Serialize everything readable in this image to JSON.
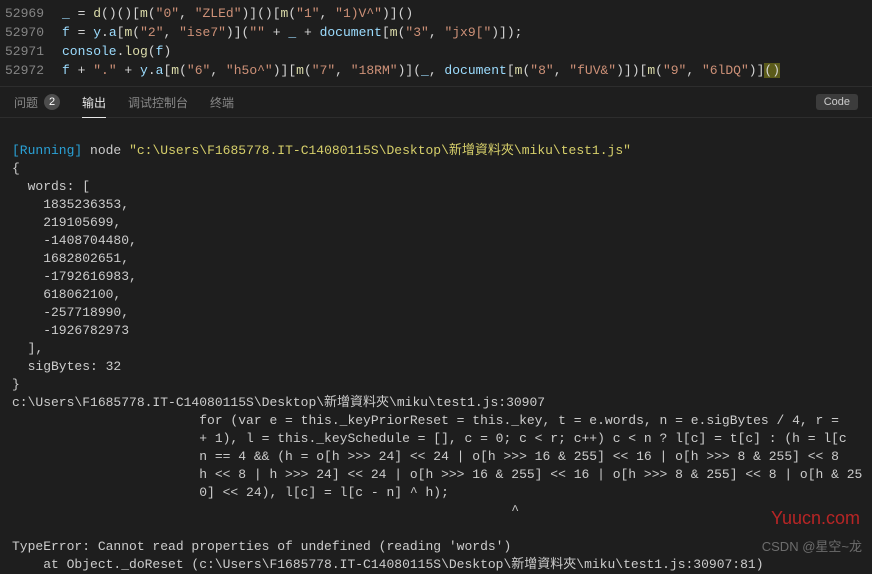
{
  "editor": {
    "lines": [
      {
        "num": "52969",
        "html": "<span class='tok-id'>_</span> = <span class='tok-fn'>d</span>()()[<span class='tok-fn'>m</span>(<span class='tok-str'>\"0\"</span>, <span class='tok-str'>\"ZLEd\"</span>)]()[<span class='tok-fn'>m</span>(<span class='tok-str'>\"1\"</span>, <span class='tok-str'>\"1)V^\"</span>)]()"
      },
      {
        "num": "52970",
        "html": "<span class='tok-id'>f</span> = <span class='tok-id'>y</span>.<span class='tok-id'>a</span>[<span class='tok-fn'>m</span>(<span class='tok-str'>\"2\"</span>, <span class='tok-str'>\"ise7\"</span>)](<span class='tok-str'>\"\"</span> + <span class='tok-id'>_</span> + <span class='tok-id'>document</span>[<span class='tok-fn'>m</span>(<span class='tok-str'>\"3\"</span>, <span class='tok-str'>\"jx9[\"</span>)]);"
      },
      {
        "num": "52971",
        "html": "<span class='tok-id'>console</span>.<span class='tok-fn'>log</span>(<span class='tok-id'>f</span>)"
      },
      {
        "num": "52972",
        "html": "<span class='tok-id'>f</span> + <span class='tok-str'>\".\"</span> + <span class='tok-id'>y</span>.<span class='tok-id'>a</span>[<span class='tok-fn'>m</span>(<span class='tok-str'>\"6\"</span>, <span class='tok-str'>\"h5o^\"</span>)][<span class='tok-fn'>m</span>(<span class='tok-str'>\"7\"</span>, <span class='tok-str'>\"18RM\"</span>)](<span class='tok-id'>_</span>, <span class='tok-id'>document</span>[<span class='tok-fn'>m</span>(<span class='tok-str'>\"8\"</span>, <span class='tok-str'>\"fUV&amp;\"</span>)])[<span class='tok-fn'>m</span>(<span class='tok-str'>\"9\"</span>, <span class='tok-str'>\"6lDQ\"</span>)]<span class='tok-paren-y'>()</span>"
      }
    ]
  },
  "panel": {
    "tabs": {
      "problems": "问题",
      "problems_count": "2",
      "output": "输出",
      "debug": "调试控制台",
      "terminal": "终端"
    },
    "selector": "Code"
  },
  "terminal": {
    "running_label": "[Running]",
    "cmd_node": "node",
    "cmd_path": "\"c:\\Users\\F1685778.IT-C14080115S\\Desktop\\新增資料夾\\miku\\test1.js\"",
    "obj_open": "{",
    "words_open": "  words: [",
    "values": [
      "    1835236353,",
      "    219105699,",
      "    -1408704480,",
      "    1682802651,",
      "    -1792616983,",
      "    618062100,",
      "    -257718990,",
      "    -1926782973"
    ],
    "words_close": "  ],",
    "sigbytes": "  sigBytes: 32",
    "obj_close": "}",
    "trace_path": "c:\\Users\\F1685778.IT-C14080115S\\Desktop\\新增資料夾\\miku\\test1.js:30907",
    "for_l1": "                        for (var e = this._keyPriorReset = this._key, t = e.words, n = e.sigBytes / 4, r = ",
    "for_l2": "                        + 1), l = this._keySchedule = [], c = 0; c < r; c++) c < n ? l[c] = t[c] : (h = l[c",
    "for_l3": "                        n == 4 && (h = o[h >>> 24] << 24 | o[h >>> 16 & 255] << 16 | o[h >>> 8 & 255] << 8 ",
    "for_l4": "                        h << 8 | h >>> 24] << 24 | o[h >>> 16 & 255] << 16 | o[h >>> 8 & 255] << 8 | o[h & 25",
    "for_l5": "                        0] << 24), l[c] = l[c - n] ^ h);",
    "caret": "                                                                ^",
    "blank": " ",
    "err": "TypeError: Cannot read properties of undefined (reading 'words')",
    "err2": "    at Object._doReset (c:\\Users\\F1685778.IT-C14080115S\\Desktop\\新增資料夾\\miku\\test1.js:30907:81)"
  },
  "watermarks": {
    "w1": "Yuucn.com",
    "w2": "CSDN @星空~龙"
  }
}
